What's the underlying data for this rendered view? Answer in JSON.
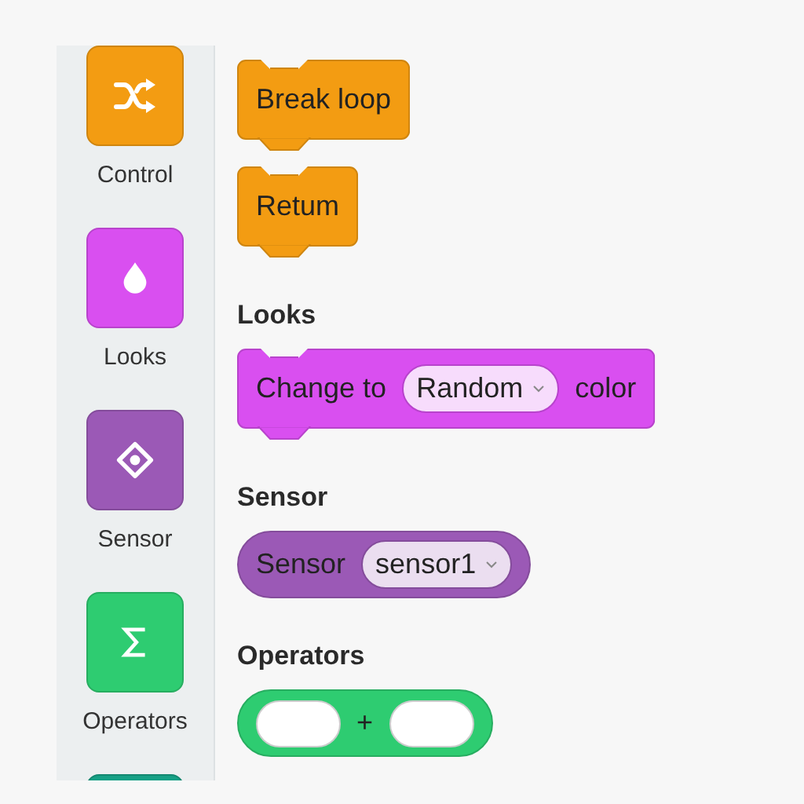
{
  "sidebar": {
    "categories": [
      {
        "label": "Control",
        "color": "#f39c12"
      },
      {
        "label": "Looks",
        "color": "#d94ff0"
      },
      {
        "label": "Sensor",
        "color": "#9b59b6"
      },
      {
        "label": "Operators",
        "color": "#2ecc71"
      },
      {
        "color": "#16a085"
      }
    ]
  },
  "palette": {
    "sections": [
      {
        "blocks": [
          {
            "kind": "stack",
            "color": "#f39c12",
            "parts": [
              {
                "kind": "text",
                "text": "Break loop"
              }
            ]
          },
          {
            "kind": "stack",
            "color": "#f39c12",
            "parts": [
              {
                "kind": "text",
                "text": "Retum"
              }
            ]
          }
        ]
      },
      {
        "heading": "Looks",
        "blocks": [
          {
            "kind": "stack",
            "color": "#d94ff0",
            "parts": [
              {
                "kind": "text",
                "text": "Change to"
              },
              {
                "kind": "dropdown",
                "value": "Random"
              },
              {
                "kind": "text",
                "text": "color"
              }
            ]
          }
        ]
      },
      {
        "heading": "Sensor",
        "blocks": [
          {
            "kind": "reporter",
            "color": "#9b59b6",
            "parts": [
              {
                "kind": "text",
                "text": "Sensor"
              },
              {
                "kind": "dropdown",
                "value": "sensor1"
              }
            ]
          }
        ]
      },
      {
        "heading": "Operators",
        "blocks": [
          {
            "kind": "reporter",
            "color": "#2ecc71",
            "parts": [
              {
                "kind": "slot"
              },
              {
                "kind": "text",
                "text": "+"
              },
              {
                "kind": "slot"
              }
            ]
          }
        ]
      }
    ]
  }
}
